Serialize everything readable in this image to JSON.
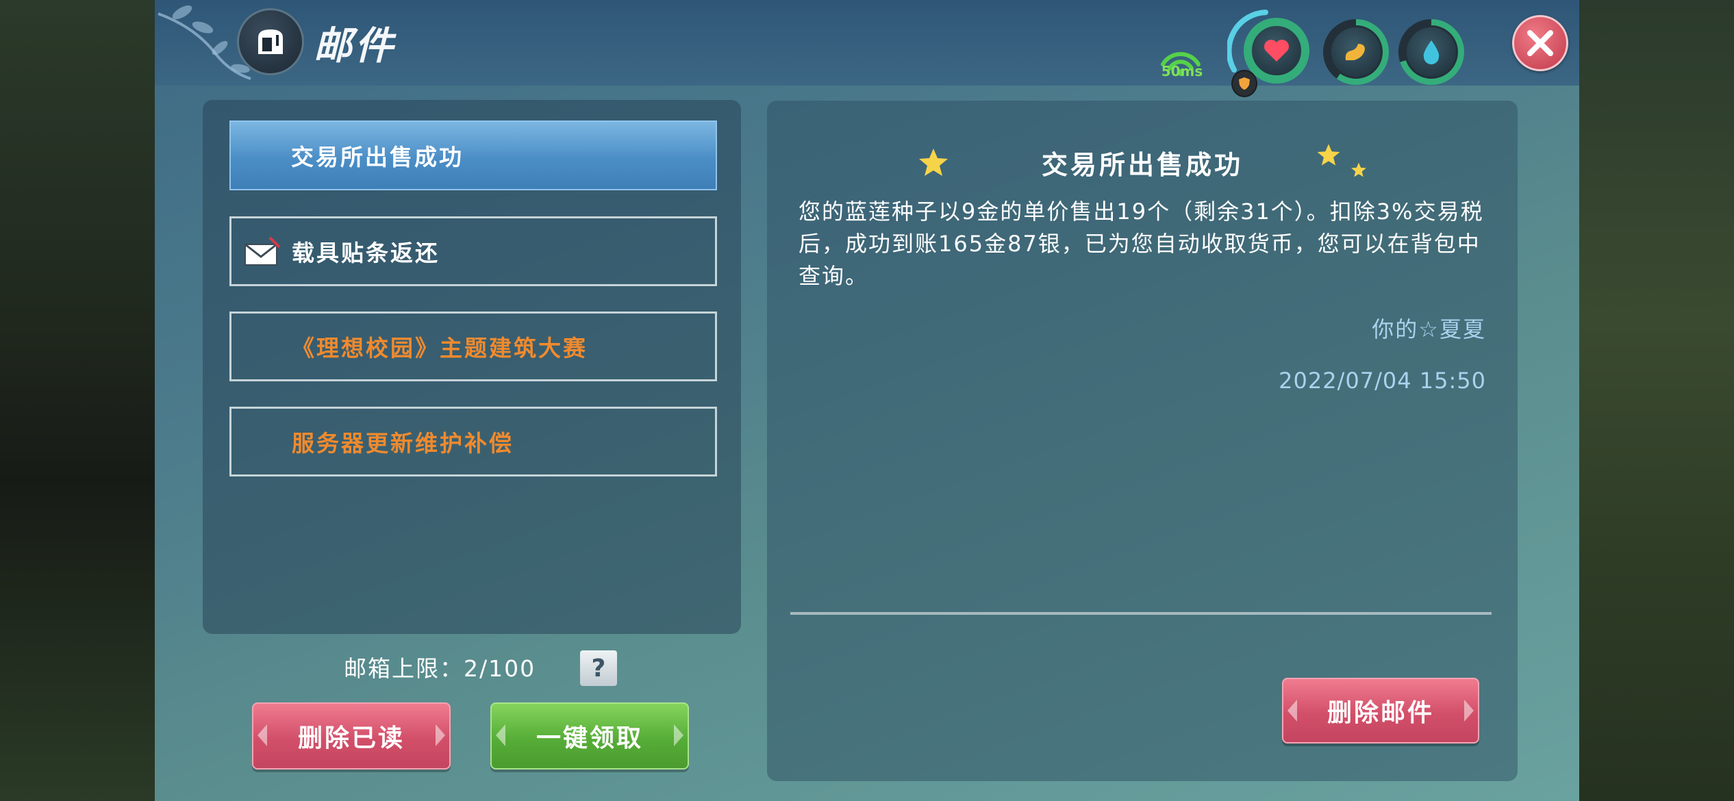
{
  "window": {
    "title": "邮件",
    "ping": "50ms",
    "close_icon": "close-icon"
  },
  "mail_list": [
    {
      "label": "交易所出售成功",
      "selected": true,
      "color": "#ffffff"
    },
    {
      "label": "载具贴条返还",
      "selected": false,
      "color": "#ffffff",
      "icon": "envelope-icon"
    },
    {
      "label": "《理想校园》主题建筑大赛",
      "selected": false,
      "color": "#f08a2e"
    },
    {
      "label": "服务器更新维护补偿",
      "selected": false,
      "color": "#f08a2e"
    }
  ],
  "footer": {
    "capacity": "邮箱上限：2/100",
    "help": "?",
    "delete_read": "删除已读",
    "claim_all": "一键领取"
  },
  "detail": {
    "title": "交易所出售成功",
    "body": "您的蓝莲种子以9金的单价售出19个（剩余31个）。扣除3%交易税后，成功到账165金87银，已为您自动收取货币，您可以在背包中查询。",
    "sender": "你的☆夏夏",
    "date": "2022/07/04 15:50",
    "delete_mail": "删除邮件"
  },
  "colors": {
    "accent_blue": "#4b8ec6",
    "orange_text": "#f08a2e",
    "red_button": "#d24f69",
    "green_button": "#56ad37",
    "ping_green": "#7ee15a",
    "meta_blue": "#a9d3ee"
  }
}
